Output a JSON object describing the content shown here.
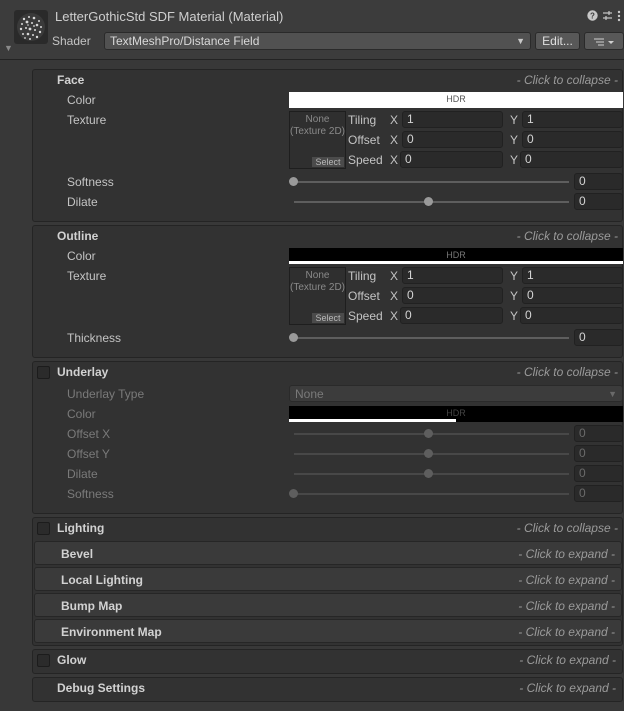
{
  "header": {
    "title": "LetterGothicStd SDF Material (Material)",
    "shader_label": "Shader",
    "shader_value": "TextMeshPro/Distance Field",
    "edit_button": "Edit...",
    "icons": [
      "help-icon",
      "preset-icon",
      "more-icon",
      "list-menu-icon"
    ]
  },
  "face": {
    "title": "Face",
    "collapse": "- Click to collapse -",
    "color_label": "Color",
    "color_value": "#ffffff",
    "hdr": "HDR",
    "texture_label": "Texture",
    "texture_none": "None (Texture 2D)",
    "select": "Select",
    "tiling": "Tiling",
    "offset": "Offset",
    "speed": "Speed",
    "x": "X",
    "y": "Y",
    "tiling_x": "1",
    "tiling_y": "1",
    "offset_x": "0",
    "offset_y": "0",
    "speed_x": "0",
    "speed_y": "0",
    "softness_label": "Softness",
    "softness_value": "0",
    "dilate_label": "Dilate",
    "dilate_value": "0"
  },
  "outline": {
    "title": "Outline",
    "collapse": "- Click to collapse -",
    "color_label": "Color",
    "color_value": "#000000",
    "hdr": "HDR",
    "texture_label": "Texture",
    "texture_none": "None (Texture 2D)",
    "select": "Select",
    "tiling": "Tiling",
    "offset": "Offset",
    "speed": "Speed",
    "x": "X",
    "y": "Y",
    "tiling_x": "1",
    "tiling_y": "1",
    "offset_x": "0",
    "offset_y": "0",
    "speed_x": "0",
    "speed_y": "0",
    "thickness_label": "Thickness",
    "thickness_value": "0"
  },
  "underlay": {
    "title": "Underlay",
    "collapse": "- Click to collapse -",
    "type_label": "Underlay Type",
    "type_value": "None",
    "color_label": "Color",
    "color_value": "#000000",
    "hdr": "HDR",
    "offset_x_label": "Offset X",
    "offset_x_value": "0",
    "offset_y_label": "Offset Y",
    "offset_y_value": "0",
    "dilate_label": "Dilate",
    "dilate_value": "0",
    "softness_label": "Softness",
    "softness_value": "0"
  },
  "lighting": {
    "title": "Lighting",
    "collapse": "- Click to collapse -",
    "subsections": [
      {
        "title": "Bevel",
        "action": "- Click to expand -"
      },
      {
        "title": "Local Lighting",
        "action": "- Click to expand -"
      },
      {
        "title": "Bump Map",
        "action": "- Click to expand -"
      },
      {
        "title": "Environment Map",
        "action": "- Click to expand -"
      }
    ]
  },
  "glow": {
    "title": "Glow",
    "action": "- Click to expand -"
  },
  "debug": {
    "title": "Debug Settings",
    "action": "- Click to expand -"
  }
}
